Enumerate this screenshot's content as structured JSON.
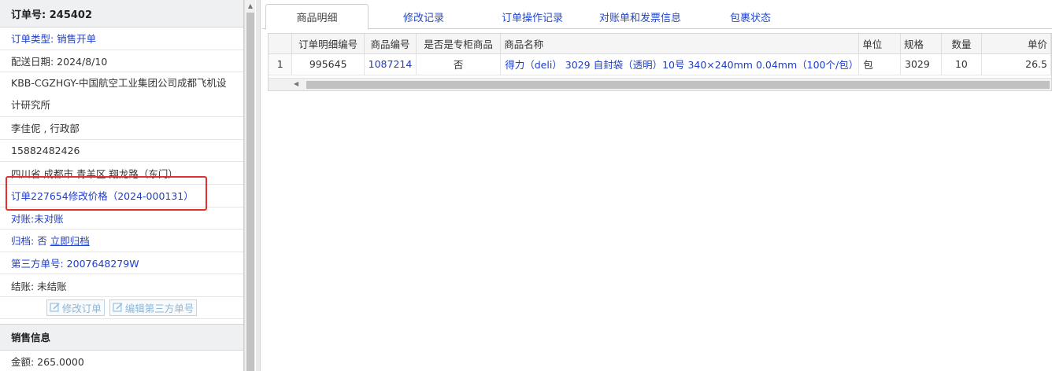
{
  "order": {
    "header": "订单号: 245402",
    "type": "订单类型: 销售开单",
    "delivery_date": "配送日期: 2024/8/10",
    "customer": "KBB-CGZHGY-中国航空工业集团公司成都飞机设计研究所",
    "contact": "李佳伲 , 行政部",
    "phone": "15882482426",
    "address": "四川省 成都市 青羊区 翔龙路（东门）",
    "price_change": "订单227654修改价格（2024-000131）",
    "reconcile_label": "对账: ",
    "reconcile_value": "未对账",
    "archive_label": "归档: ",
    "archive_value": "否",
    "archive_action": "立即归档",
    "third_party": "第三方单号: 2007648279W",
    "settle": "结账: 未结账",
    "edit_order_btn": "修改订单",
    "edit_third_btn": "编辑第三方单号"
  },
  "sales": {
    "header": "销售信息",
    "amount": "金额: 265.0000"
  },
  "tabs": [
    "商品明细",
    "修改记录",
    "订单操作记录",
    "对账单和发票信息",
    "包裹状态"
  ],
  "grid": {
    "columns": [
      "",
      "订单明细编号",
      "商品编号",
      "是否是专柜商品",
      "商品名称",
      "单位",
      "规格",
      "数量",
      "单价"
    ],
    "rows": [
      {
        "num": "1",
        "detail_id": "995645",
        "product_id": "1087214",
        "counter": "否",
        "name": "得力（deli） 3029 自封袋（透明）10号 340×240mm 0.04mm（100个/包）",
        "unit": "包",
        "spec": "3029",
        "qty": "10",
        "price": "26.5"
      }
    ]
  },
  "colors": {
    "link": "#1e3dc8",
    "highlight_box": "#e23030"
  }
}
